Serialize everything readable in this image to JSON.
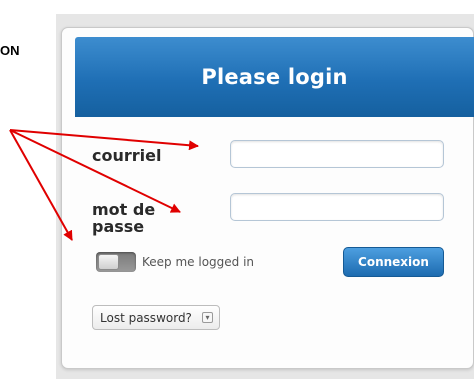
{
  "side_text": "ON",
  "login": {
    "title": "Please login",
    "email_label": "courriel",
    "password_label": "mot de passe",
    "email_value": "",
    "password_value": "",
    "keep_logged_in": "Keep me logged in",
    "keep_logged_in_enabled": false,
    "submit_label": "Connexion",
    "lost_password": "Lost password?"
  },
  "colors": {
    "header": "#1f6fb5",
    "button": "#1d6bb0",
    "arrow": "#e00000"
  },
  "icons": {
    "lost_password_toggle": "chevron-down-icon"
  }
}
